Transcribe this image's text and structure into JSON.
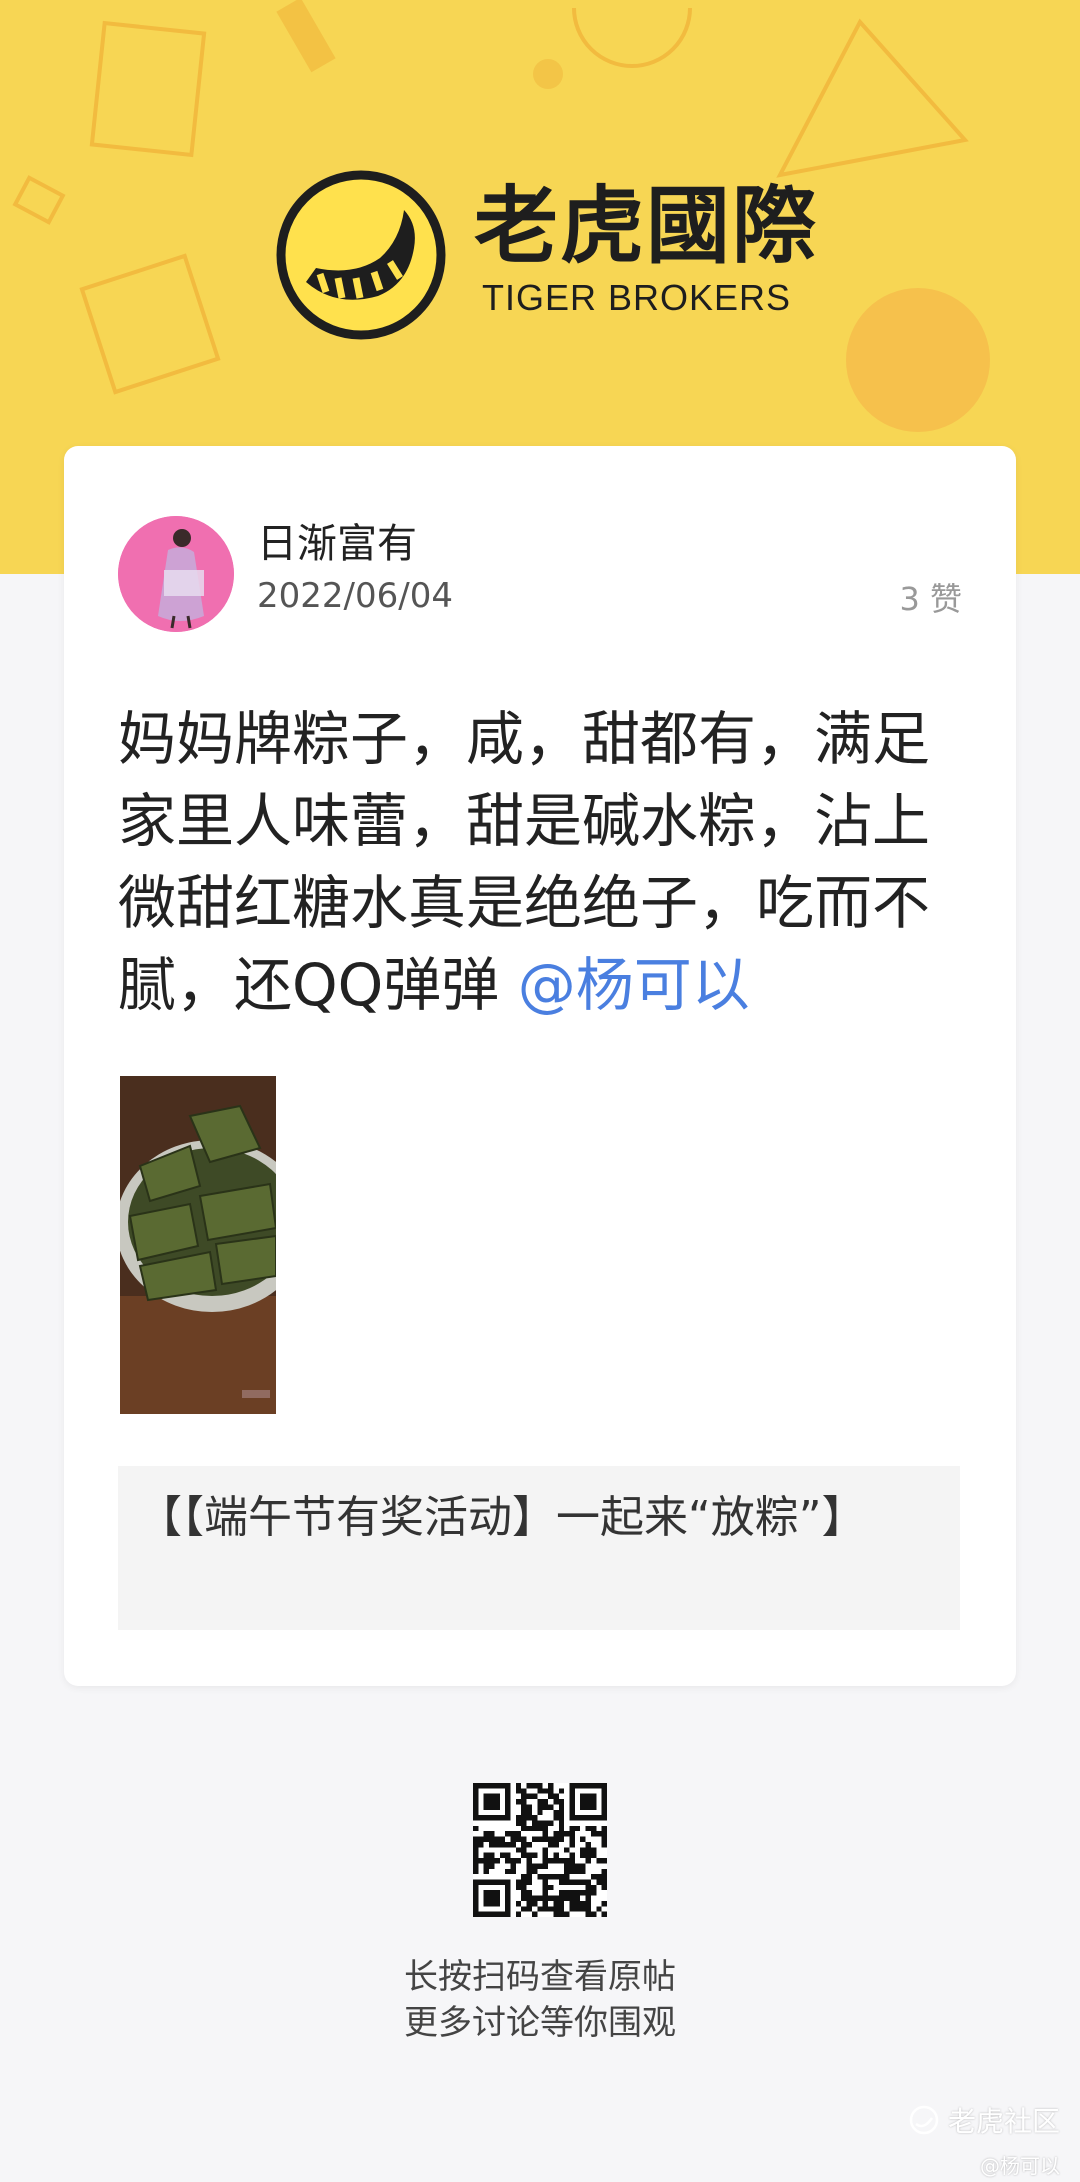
{
  "header": {
    "brand_cn": "老虎國際",
    "brand_en": "TIGER BROKERS"
  },
  "post": {
    "author": "日渐富有",
    "date": "2022/06/04",
    "likes": "3 赞",
    "body_text": "妈妈牌粽子，咸，甜都有，满足家里人味蕾，甜是碱水粽，沾上微甜红糖水真是绝绝子，吃而不腻，还QQ弹弹 ",
    "mention": "@杨可以",
    "topic": "【【端午节有奖活动】一起来“放粽”】"
  },
  "share": {
    "line1": "长按扫码查看原帖",
    "line2": "更多讨论等你围观"
  },
  "footer": {
    "brand": "老虎社区",
    "handle": "@杨可以"
  },
  "colors": {
    "banner": "#f7d654",
    "mention": "#4a7fe0",
    "page_bg": "#f6f6f8"
  }
}
